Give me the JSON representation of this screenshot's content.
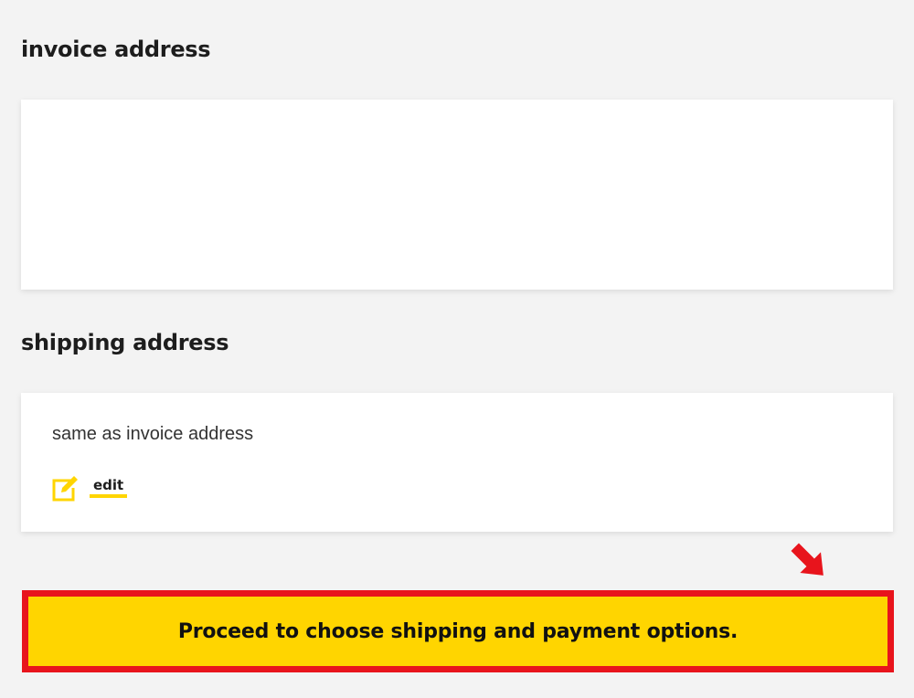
{
  "invoice": {
    "title": "invoice address"
  },
  "shipping": {
    "title": "shipping address",
    "same_as_text": "same as invoice address",
    "edit_label": "edit",
    "edit_icon": "edit-pencil-icon"
  },
  "proceed": {
    "label": "Proceed to choose shipping and payment options."
  },
  "colors": {
    "accent_yellow": "#ffd500",
    "highlight_red": "#e8141c",
    "background": "#f3f3f3",
    "card": "#ffffff"
  }
}
